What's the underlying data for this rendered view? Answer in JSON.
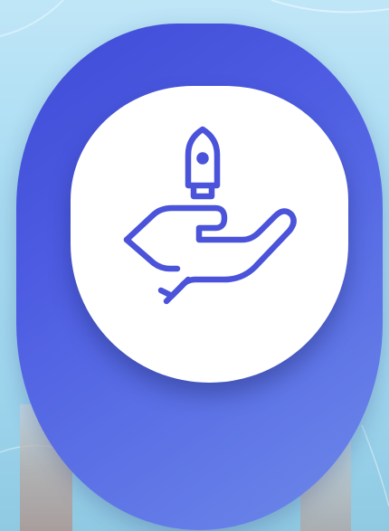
{
  "icon": {
    "name": "hand-holding-rocket-icon",
    "color": "#4a53d9"
  },
  "theme": {
    "card_color_start": "#3f4bd6",
    "card_color_end": "#6d8ae9",
    "tile_color": "#ffffff",
    "background_sky": "#a9dcf2"
  }
}
